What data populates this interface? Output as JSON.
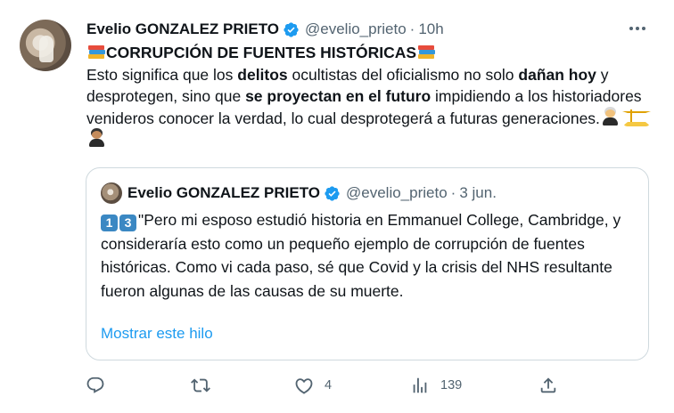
{
  "tweet": {
    "author_name": "Evelio GONZALEZ PRIETO",
    "handle": "@evelio_prieto",
    "separator": "·",
    "time": "10h",
    "title": "CORRUPCIÓN DE FUENTES HISTÓRICAS",
    "body": {
      "t1": "Esto significa que los ",
      "b1": "delitos",
      "t2": " ocultistas del oficialismo no solo ",
      "b2": "dañan hoy",
      "t3": " y desprotegen, sino que ",
      "b3": "se proyectan en el futuro",
      "t4": " impidiendo a los historiadores venideros conocer la verdad, lo cual desprotegerá a futuras generaciones."
    }
  },
  "quoted": {
    "author_name": "Evelio GONZALEZ PRIETO",
    "handle": "@evelio_prieto",
    "separator": "·",
    "time": "3 jun.",
    "keycap1": "1",
    "keycap2": "3",
    "text": "\"Pero mi esposo estudió historia en Emmanuel College, Cambridge, y consideraría esto como un pequeño ejemplo de corrupción de fuentes históricas. Como vi cada paso, sé que Covid y la crisis del NHS resultante fueron algunas de las causas de su muerte.",
    "show_thread": "Mostrar este hilo"
  },
  "actions": {
    "reply_count": "",
    "retweet_count": "",
    "like_count": "4",
    "views_count": "139"
  },
  "colors": {
    "text": "#0f1419",
    "secondary": "#536471",
    "link": "#1d9bf0",
    "border": "#cfd9de",
    "verified": "#1d9bf0"
  },
  "icons": [
    "verified-badge-icon",
    "more-icon",
    "reply-icon",
    "retweet-icon",
    "like-icon",
    "views-icon",
    "share-icon",
    "books-emoji",
    "judge-emoji",
    "scales-emoji",
    "keycap-emoji"
  ]
}
